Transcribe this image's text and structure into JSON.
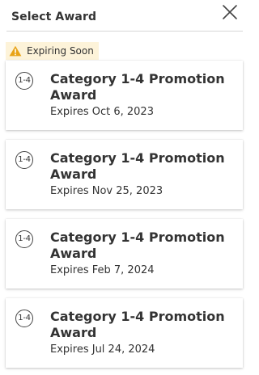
{
  "header": {
    "title": "Select Award",
    "close_icon": "close-icon"
  },
  "badge": {
    "label": "Expiring Soon",
    "icon": "warning-icon",
    "icon_color": "#e8a317",
    "background": "#fdf3d9"
  },
  "awards": [
    {
      "icon_label": "1-4",
      "title": "Category 1-4 Promotion Award",
      "expires": "Expires Oct 6, 2023"
    },
    {
      "icon_label": "1-4",
      "title": "Category 1-4 Promotion Award",
      "expires": "Expires Nov 25, 2023"
    },
    {
      "icon_label": "1-4",
      "title": "Category 1-4 Promotion Award",
      "expires": "Expires Feb 7, 2024"
    },
    {
      "icon_label": "1-4",
      "title": "Category 1-4 Promotion Award",
      "expires": "Expires Jul 24, 2024"
    }
  ]
}
